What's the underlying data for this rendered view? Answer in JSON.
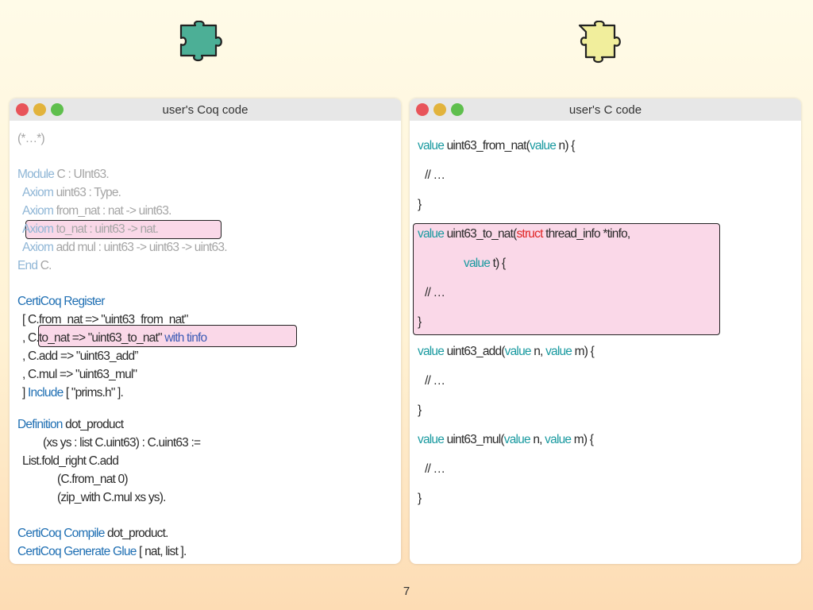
{
  "left_window": {
    "title": "user's Coq code",
    "lines": {
      "l1": "(*…*)",
      "l2a": "Module",
      "l2b": " C : UInt63.",
      "l3a": "Axiom",
      "l3b": " uint63 : Type.",
      "l4a": "Axiom",
      "l4b": " from_nat : nat -> uint63.",
      "l5a": "Axiom",
      "l5b": " to_nat : uint63 -> nat.",
      "l6a": "Axiom",
      "l6b": " add mul : uint63 -> uint63 -> uint63.",
      "l7a": "End",
      "l7b": " C.",
      "l8a": "CertiCoq Register",
      "l9": "[ C.from_nat => \"uint63_from_nat\"",
      "l10a": ", C.to_nat => \"uint63_to_nat\" ",
      "l10b": "with tinfo",
      "l11": ", C.add => \"uint63_add”",
      "l12": ", C.mul => \"uint63_mul\"",
      "l13a": "] ",
      "l13b": "Include",
      "l13c": " [ \"prims.h\" ].",
      "l14a": "Definition",
      "l14b": " dot_product",
      "l15": "(xs ys : list C.uint63) : C.uint63 :=",
      "l16": "List.fold_right C.add",
      "l17": "(C.from_nat 0)",
      "l18": "(zip_with C.mul xs ys).",
      "l19a": "CertiCoq Compile",
      "l19b": " dot_product.",
      "l20a": "CertiCoq Generate Glue",
      "l20b": " [ nat, list ]."
    }
  },
  "right_window": {
    "title": "user's C code",
    "lines": {
      "r1a": "value",
      "r1b": " uint63_from_nat(",
      "r1c": "value",
      "r1d": " n) {",
      "r2": "// …",
      "r3": "}",
      "r4a": "value",
      "r4b": " uint63_to_nat(",
      "r4c": "struct",
      "r4d": " thread_info *tinfo,",
      "r5a": "value",
      "r5b": " t) {",
      "r6": "// …",
      "r7": "}",
      "r8a": "value",
      "r8b": " uint63_add(",
      "r8c": "value",
      "r8d": " n, ",
      "r8e": "value",
      "r8f": " m) {",
      "r9": "// …",
      "r10": "}",
      "r11a": "value",
      "r11b": " uint63_mul(",
      "r11c": "value",
      "r11d": " n, ",
      "r11e": "value",
      "r11f": " m) {",
      "r12": "// …",
      "r13": "}"
    }
  },
  "page_number": "7",
  "colors": {
    "teal_piece": "#4caf96",
    "yellow_piece": "#f1ee9c",
    "keyword_blue": "#1f6fb3",
    "keyword_teal": "#1a9aa0",
    "keyword_red": "#e02525"
  }
}
